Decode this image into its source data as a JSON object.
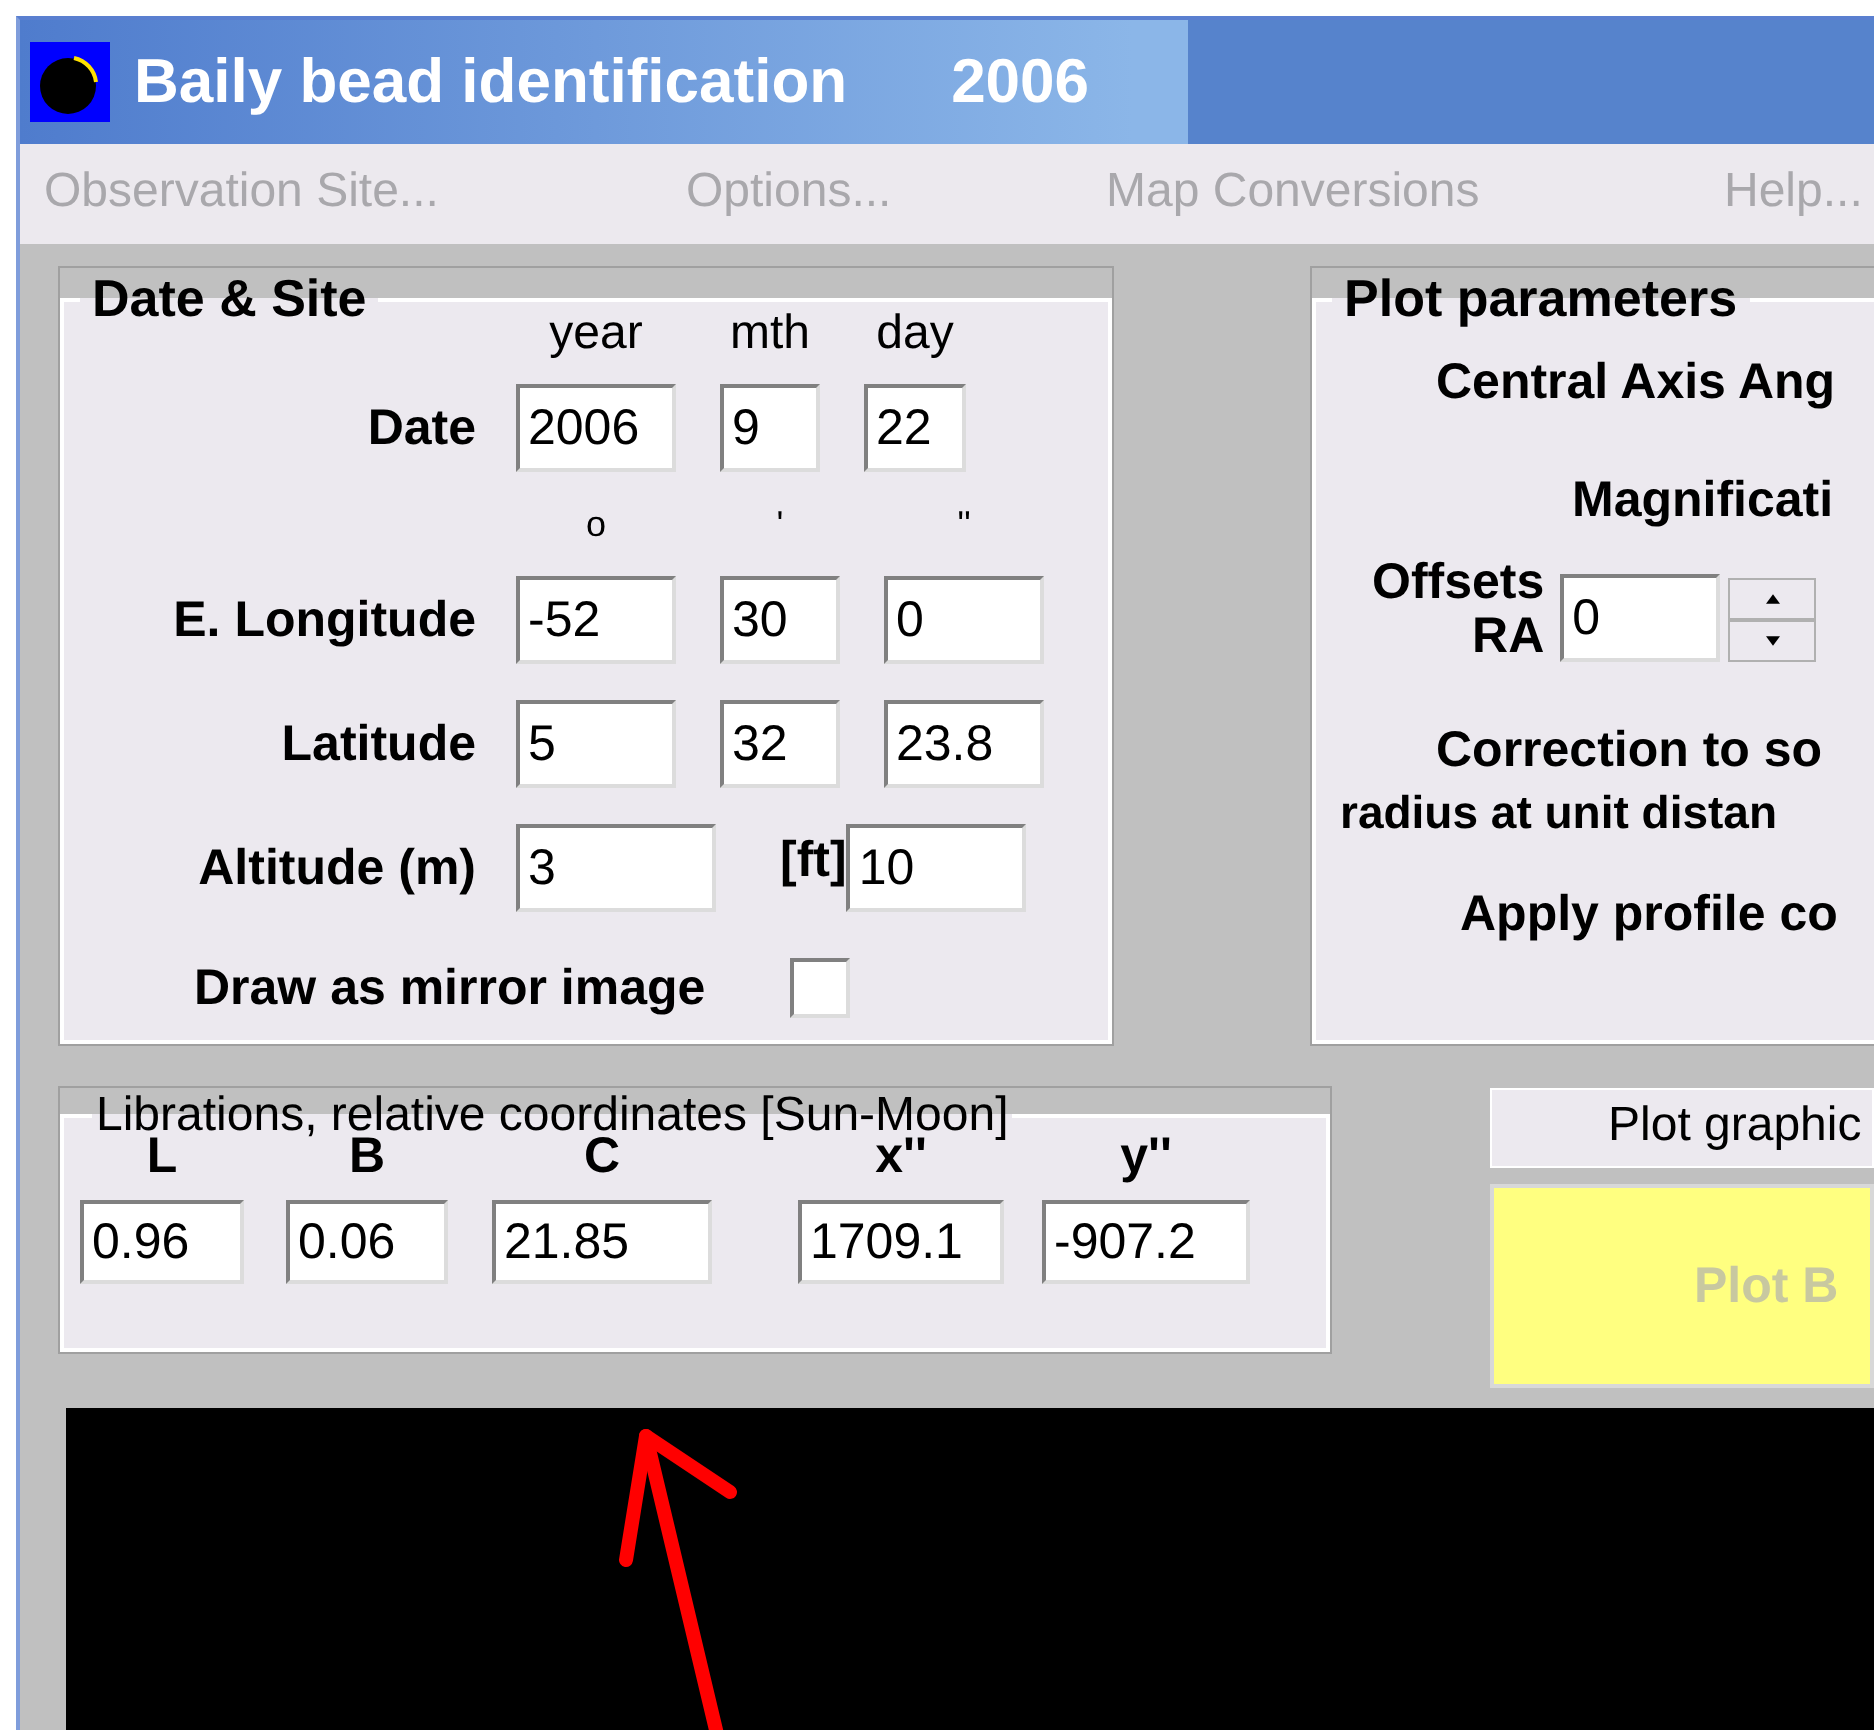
{
  "window": {
    "title": "Baily bead identification",
    "year": "2006"
  },
  "menu": [
    {
      "label": "Observation Site...",
      "disabled": true
    },
    {
      "label": "Options...",
      "disabled": true
    },
    {
      "label": "Map Conversions",
      "disabled": true
    },
    {
      "label": "Help...",
      "disabled": true
    }
  ],
  "date_site": {
    "title": "Date & Site",
    "header": [
      "year",
      "mth",
      "day"
    ],
    "units": [
      "o",
      "'",
      "''"
    ],
    "rows": [
      {
        "label": "Date",
        "values": [
          "2006",
          "9",
          "22"
        ]
      },
      {
        "label": "E. Longitude",
        "values": [
          "-52",
          "30",
          "0"
        ]
      },
      {
        "label": "Latitude",
        "values": [
          "5",
          "32",
          "23.8"
        ]
      }
    ],
    "altitude": {
      "label": "Altitude (m)",
      "value": "3",
      "ft_label": "[ft]",
      "ft_value": "10"
    },
    "mirror": {
      "label": "Draw as mirror image",
      "checked": false
    }
  },
  "plot_parameters": {
    "title": "Plot parameters",
    "central_axis": "Central Axis Ang",
    "magnification": "Magnificati",
    "offsets": "Offsets",
    "ra_label": "RA",
    "ra_value": "0",
    "correction": [
      "Correction to so",
      "radius at unit distan"
    ],
    "apply": "Apply profile co"
  },
  "librations": {
    "title": "Librations, relative coordinates [Sun-Moon]",
    "columns": [
      {
        "label": "L",
        "value": "0.96"
      },
      {
        "label": "B",
        "value": "0.06"
      },
      {
        "label": "C",
        "value": "21.85"
      },
      {
        "label": "x''",
        "value": "1709.1"
      },
      {
        "label": "y''",
        "value": "-907.2"
      }
    ]
  },
  "plot_graphic": {
    "label": "Plot graphic",
    "button": "Plot B"
  }
}
